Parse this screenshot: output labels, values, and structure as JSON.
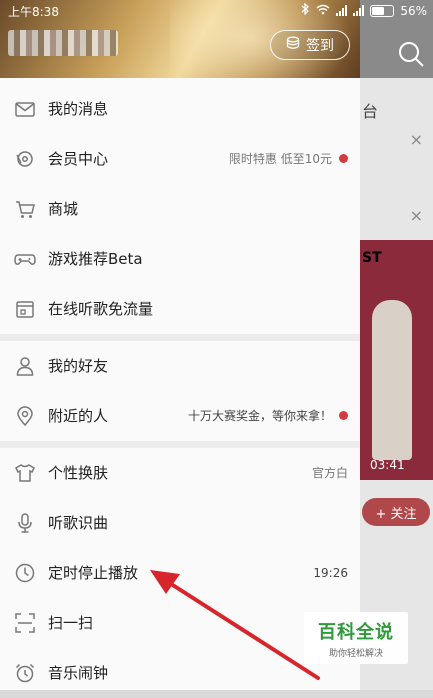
{
  "status_bar": {
    "time": "上午8:38",
    "battery": "56%"
  },
  "background": {
    "partial_text": "台",
    "close_mark": "×",
    "card_text": "ST",
    "duration": "03:41",
    "follow_button": "+ 关注"
  },
  "header": {
    "checkin_label": "签到"
  },
  "menu": {
    "items": [
      {
        "label": "我的消息",
        "icon": "mail-icon"
      },
      {
        "label": "会员中心",
        "icon": "vip-icon",
        "extra": "限时特惠 低至10元",
        "dot": true
      },
      {
        "label": "商城",
        "icon": "cart-icon"
      },
      {
        "label": "游戏推荐Beta",
        "icon": "gamepad-icon"
      },
      {
        "label": "在线听歌免流量",
        "icon": "sim-card-icon"
      },
      {
        "label": "我的好友",
        "icon": "person-icon"
      },
      {
        "label": "附近的人",
        "icon": "location-pin-icon",
        "extra": "十万大赛奖金，等你来拿！",
        "dot": true
      },
      {
        "label": "个性换肤",
        "icon": "tshirt-icon",
        "extra": "官方白"
      },
      {
        "label": "听歌识曲",
        "icon": "microphone-icon"
      },
      {
        "label": "定时停止播放",
        "icon": "clock-icon",
        "extra": "19:26"
      },
      {
        "label": "扫一扫",
        "icon": "scan-icon"
      },
      {
        "label": "音乐闹钟",
        "icon": "alarm-clock-icon"
      }
    ]
  },
  "watermark": {
    "title": "百科全说",
    "subtitle": "助你轻松解决"
  },
  "colors": {
    "accent_red": "#d33a3f",
    "arrow_red": "#d8252b",
    "watermark_green": "#2f9a3a"
  }
}
